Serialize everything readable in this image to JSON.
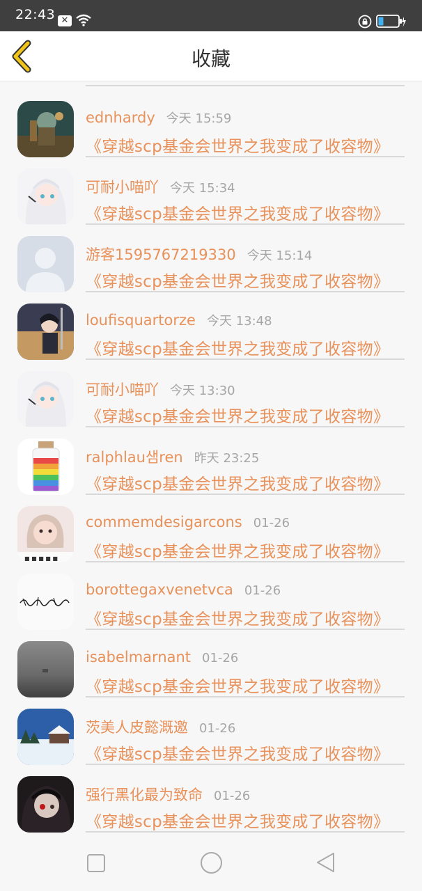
{
  "status_bar": {
    "time": "22:43",
    "icons": [
      "close-notification-icon",
      "wifi-icon",
      "lock-rotation-icon",
      "battery-icon"
    ]
  },
  "header": {
    "title": "收藏",
    "back_icon": "chevron-left-icon",
    "accent": "#f0c419"
  },
  "colors": {
    "accent_orange": "#e8915a",
    "time_gray": "#a6a6a6",
    "divider": "#d9d9d9"
  },
  "items": [
    {
      "name": "ednhardy",
      "time": "今天 15:59",
      "title": "《穿越scp基金会世界之我变成了收容物》"
    },
    {
      "name": "可耐小喵吖",
      "time": "今天 15:34",
      "title": "《穿越scp基金会世界之我变成了收容物》"
    },
    {
      "name": "游客1595767219330",
      "time": "今天 15:14",
      "title": "《穿越scp基金会世界之我变成了收容物》"
    },
    {
      "name": "loufisquartorze",
      "time": "今天 13:48",
      "title": "《穿越scp基金会世界之我变成了收容物》"
    },
    {
      "name": "可耐小喵吖",
      "time": "今天 13:30",
      "title": "《穿越scp基金会世界之我变成了收容物》"
    },
    {
      "name": "ralphlau샘ren",
      "time": "昨天 23:25",
      "title": "《穿越scp基金会世界之我变成了收容物》"
    },
    {
      "name": "commemdesigarcons",
      "time": "01-26",
      "title": "《穿越scp基金会世界之我变成了收容物》"
    },
    {
      "name": "borottegaxvenetvca",
      "time": "01-26",
      "title": "《穿越scp基金会世界之我变成了收容物》"
    },
    {
      "name": "isabelmarnant",
      "time": "01-26",
      "title": "《穿越scp基金会世界之我变成了收容物》"
    },
    {
      "name": "茨美人皮懿溉邀",
      "time": "01-26",
      "title": "《穿越scp基金会世界之我变成了收容物》"
    },
    {
      "name": "强行黑化最为致命",
      "time": "01-26",
      "title": "《穿越scp基金会世界之我变成了收容物》"
    }
  ],
  "nav": {
    "recents_icon": "square-icon",
    "home_icon": "circle-icon",
    "back_icon": "triangle-back-icon"
  }
}
